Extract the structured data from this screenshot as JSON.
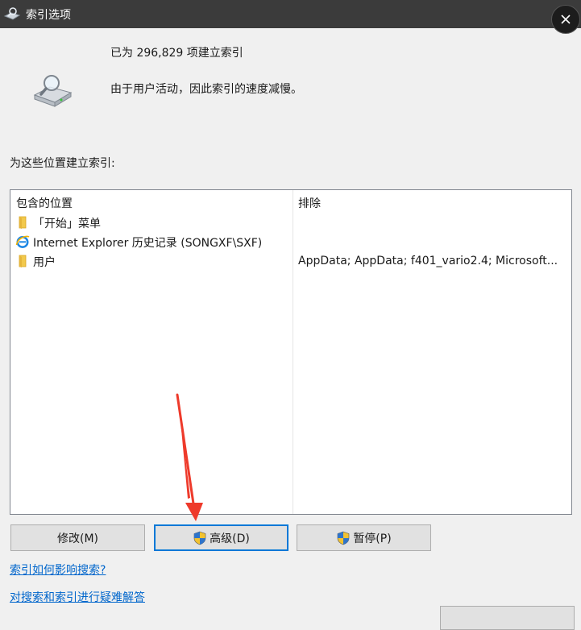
{
  "window": {
    "title": "索引选项"
  },
  "status": {
    "indexed_count_text": "已为 296,829 项建立索引",
    "speed_text": "由于用户活动，因此索引的速度减慢。"
  },
  "locations": {
    "section_label": "为这些位置建立索引:",
    "columns": {
      "included": "包含的位置",
      "exclude": "排除"
    },
    "rows": [
      {
        "icon": "folder-icon",
        "location": "「开始」菜单",
        "exclude": ""
      },
      {
        "icon": "ie-icon",
        "location": "Internet Explorer 历史记录 (SONGXF\\SXF)",
        "exclude": ""
      },
      {
        "icon": "folder-icon",
        "location": "用户",
        "exclude": "AppData; AppData; f401_vario2.4; Microsoft..."
      }
    ]
  },
  "buttons": {
    "modify": "修改(M)",
    "advanced": "高级(D)",
    "pause": "暂停(P)"
  },
  "links": {
    "how_index_affects": "索引如何影响搜索?",
    "troubleshoot": "对搜索和索引进行疑难解答"
  },
  "colors": {
    "titlebar": "#3b3b3b",
    "link": "#0066cc",
    "focus_border": "#0078d7",
    "annotation_arrow": "#ee3a2b"
  }
}
